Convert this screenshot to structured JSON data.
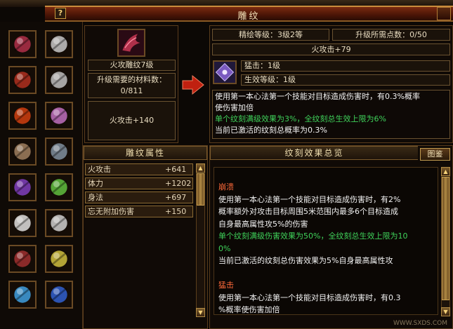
{
  "window": {
    "title": "雕纹",
    "help_label": "?"
  },
  "left_slots": [
    {
      "icon": "red-beast-claw-icon",
      "color": "#b0304a"
    },
    {
      "icon": "silver-ring-icon",
      "color": "#c8c8c8"
    },
    {
      "icon": "demon-mask-icon",
      "color": "#b03020"
    },
    {
      "icon": "silver-ring-icon",
      "color": "#bfbfbf"
    },
    {
      "icon": "scroll-icon",
      "color": "#d04010"
    },
    {
      "icon": "bracer-icon",
      "color": "#c070c0"
    },
    {
      "icon": "belt-icon",
      "color": "#a08060"
    },
    {
      "icon": "boots-icon",
      "color": "#8090a0"
    },
    {
      "icon": "purple-necklace-icon",
      "color": "#8040c0"
    },
    {
      "icon": "green-amulet-icon",
      "color": "#60c040"
    },
    {
      "icon": "bone-charm-icon",
      "color": "#e0e0e0"
    },
    {
      "icon": "bone-charm-icon",
      "color": "#d0d0d0"
    },
    {
      "icon": "gauntlet-icon",
      "color": "#a03030"
    },
    {
      "icon": "pendant-icon",
      "color": "#d0c040"
    },
    {
      "icon": "sword-icon",
      "color": "#40a0e0"
    },
    {
      "icon": "blue-talisman-icon",
      "color": "#3060d0"
    }
  ],
  "item": {
    "icon": "red-beast-claw-icon",
    "name": "火攻雕纹7级",
    "material_label": "升级需要的材料数：",
    "material_value": "0/811",
    "bonus": "火攻击+140"
  },
  "upgrade": {
    "level_text": "精绘等级：3级2等",
    "points_text": "升级所需点数：0/50",
    "stat_text": "火攻击+79",
    "skill_name": "猛击：1级",
    "effect_level": "生效等级：1级",
    "desc_lines": [
      {
        "text": "使用第一本心法第一个技能对目标造成伤害时，有0.3%概率",
        "color": "white"
      },
      {
        "text": "使伤害加倍",
        "color": "white"
      },
      {
        "text": "单个纹刻满级效果为3%，全纹刻总生效上限为6%",
        "color": "green"
      },
      {
        "text": "当前已激活的纹刻总概率为0.3%",
        "color": "white"
      }
    ]
  },
  "attributes": {
    "header": "雕纹属性",
    "rows": [
      {
        "name": "火攻击",
        "value": "+641"
      },
      {
        "name": "体力",
        "value": "+1202"
      },
      {
        "name": "身法",
        "value": "+697"
      },
      {
        "name": "忘无附加伤害",
        "value": "+150"
      }
    ]
  },
  "overview": {
    "header": "纹刻效果总览",
    "button_label": "图鉴",
    "lines": [
      {
        "text": "崩溃",
        "color": "red"
      },
      {
        "text": "使用第一本心法第一个技能对目标造成伤害时，有2%",
        "color": "white"
      },
      {
        "text": "概率额外对攻击目标周围5米范围内最多6个目标造成",
        "color": "white"
      },
      {
        "text": "自身最高属性攻5%的伤害",
        "color": "white"
      },
      {
        "text": "单个纹刻满级伤害效果为50%，全纹刻总生效上限为10",
        "color": "green"
      },
      {
        "text": "0%",
        "color": "green"
      },
      {
        "text": "当前已激活的纹刻总伤害效果为5%自身最高属性攻",
        "color": "white"
      },
      {
        "text": "",
        "color": "white"
      },
      {
        "text": "猛击",
        "color": "red"
      },
      {
        "text": "使用第一本心法第一个技能对目标造成伤害时，有0.3",
        "color": "white"
      },
      {
        "text": "%概率使伤害加倍",
        "color": "white"
      }
    ]
  },
  "watermark": "WWW.SXDS.COM"
}
